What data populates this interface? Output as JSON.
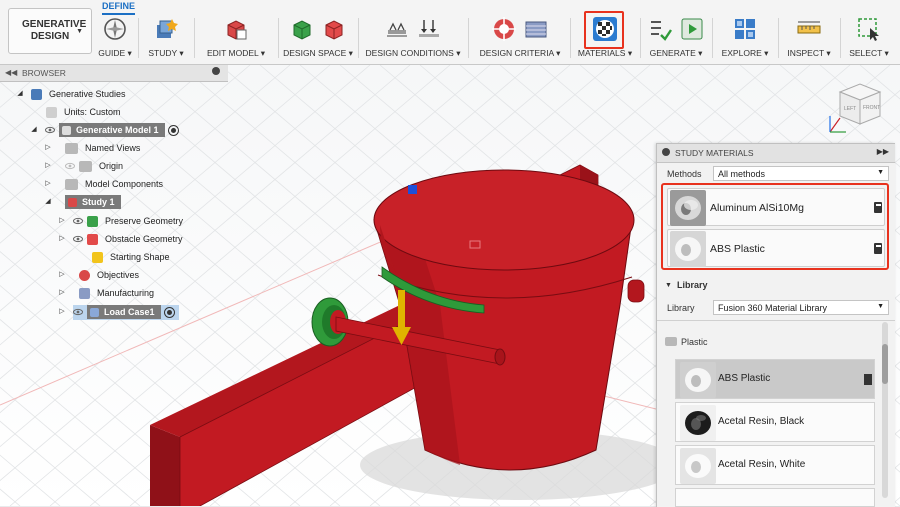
{
  "toolbar": {
    "workspace_label": "GENERATIVE DESIGN",
    "active_tab": "DEFINE",
    "groups": [
      {
        "label": "GUIDE ▾"
      },
      {
        "label": "STUDY ▾"
      },
      {
        "label": "EDIT MODEL ▾"
      },
      {
        "label": "DESIGN SPACE ▾"
      },
      {
        "label": "DESIGN CONDITIONS ▾"
      },
      {
        "label": "DESIGN CRITERIA ▾"
      },
      {
        "label": "MATERIALS ▾"
      },
      {
        "label": "GENERATE ▾"
      },
      {
        "label": "EXPLORE ▾"
      },
      {
        "label": "INSPECT ▾"
      },
      {
        "label": "SELECT ▾"
      }
    ]
  },
  "browser": {
    "title": "BROWSER",
    "items": [
      {
        "label": "Generative Studies"
      },
      {
        "label": "Units: Custom"
      },
      {
        "label": "Generative Model 1"
      },
      {
        "label": "Named Views"
      },
      {
        "label": "Origin"
      },
      {
        "label": "Model Components"
      },
      {
        "label": "Study 1"
      },
      {
        "label": "Preserve Geometry"
      },
      {
        "label": "Obstacle Geometry"
      },
      {
        "label": "Starting Shape"
      },
      {
        "label": "Objectives"
      },
      {
        "label": "Manufacturing"
      },
      {
        "label": "Load Case1"
      }
    ]
  },
  "viewcube": {
    "left": "LEFT",
    "front": "FRONT"
  },
  "panel": {
    "title": "STUDY MATERIALS",
    "methods_label": "Methods",
    "methods_value": "All methods",
    "study_materials": [
      {
        "name": "Aluminum AlSi10Mg"
      },
      {
        "name": "ABS Plastic"
      }
    ],
    "library_section": "Library",
    "library_label": "Library",
    "library_value": "Fusion 360 Material Library",
    "folder": "Plastic",
    "library_materials": [
      {
        "name": "ABS Plastic"
      },
      {
        "name": "Acetal Resin, Black"
      },
      {
        "name": "Acetal Resin, White"
      }
    ]
  },
  "colors": {
    "accent": "#1b6fc4",
    "highlight": "#e8321e",
    "model": "#c21a22",
    "preserve": "#2f9a3a",
    "load_arrow": "#e0b400"
  }
}
